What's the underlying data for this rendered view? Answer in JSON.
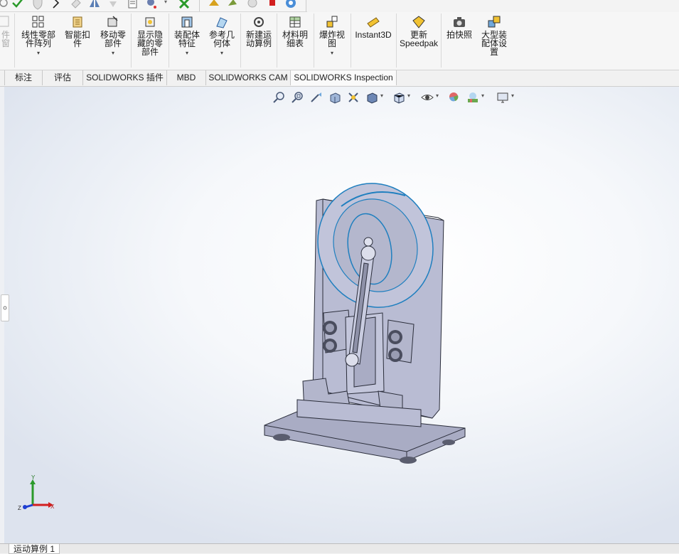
{
  "ribbon": {
    "partial_left": "件窗",
    "buttons": [
      {
        "id": "linear-pattern",
        "lines": [
          "线性零部",
          "件阵列"
        ],
        "dropdown": true
      },
      {
        "id": "smart-fastener",
        "lines": [
          "智能扣",
          "件"
        ],
        "dropdown": false
      },
      {
        "id": "move-component",
        "lines": [
          "移动零",
          "部件"
        ],
        "dropdown": true
      },
      {
        "id": "show-hidden",
        "lines": [
          "显示隐",
          "藏的零",
          "部件"
        ],
        "dropdown": false
      },
      {
        "id": "assembly-feature",
        "lines": [
          "装配体",
          "特征"
        ],
        "dropdown": true
      },
      {
        "id": "reference-geometry",
        "lines": [
          "参考几",
          "何体"
        ],
        "dropdown": true
      },
      {
        "id": "new-motion-study",
        "lines": [
          "新建运",
          "动算例"
        ],
        "dropdown": false
      },
      {
        "id": "bom",
        "lines": [
          "材料明",
          "细表"
        ],
        "dropdown": false
      },
      {
        "id": "exploded-view",
        "lines": [
          "爆炸视",
          "图"
        ],
        "dropdown": true
      },
      {
        "id": "instant3d",
        "lines": [
          "Instant3D"
        ],
        "dropdown": false
      },
      {
        "id": "update-speedpak",
        "lines": [
          "更新",
          "Speedpak"
        ],
        "dropdown": false
      },
      {
        "id": "snapshot",
        "lines": [
          "拍快照"
        ],
        "dropdown": false
      },
      {
        "id": "large-assembly",
        "lines": [
          "大型装",
          "配体设",
          "置"
        ],
        "dropdown": false
      }
    ]
  },
  "tabs": [
    "标注",
    "评估",
    "SOLIDWORKS 插件",
    "MBD",
    "SOLIDWORKS CAM",
    "SOLIDWORKS Inspection"
  ],
  "heads_up_icons": [
    "zoom-to-fit-icon",
    "zoom-to-area-icon",
    "previous-view-icon",
    "section-view-icon",
    "view-dynamic-annotation-icon",
    "display-style-icon",
    "view-orientation-icon",
    "hide-show-icon",
    "edit-appearance-icon",
    "apply-scene-icon",
    "view-settings-icon"
  ],
  "triad": {
    "x": "X",
    "y": "Y",
    "z": "Z"
  },
  "bottom_tab": "运动算例 1",
  "colors": {
    "model_fill": "#b9bcd3",
    "model_edge": "#2a2d3a",
    "wheel_edge": "#1f7fbf",
    "viewport_center": "#ffffff",
    "viewport_edge": "#dde3ee"
  }
}
